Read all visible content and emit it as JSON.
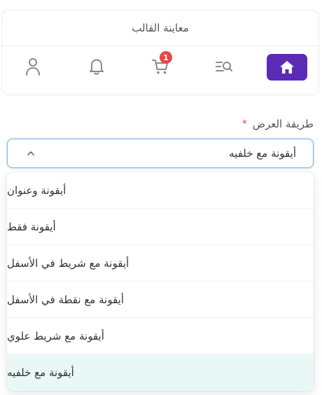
{
  "preview": {
    "title": "معاينة القالب",
    "nav_icons": [
      "home-icon",
      "search-list-icon",
      "cart-icon",
      "bell-icon",
      "user-icon"
    ],
    "cart_badge": "1"
  },
  "display_mode": {
    "label": "طريقة العرض",
    "required_mark": "*",
    "selected_value": "أيقونة مع خلفيه",
    "options": [
      "أيقونة وعنوان",
      "أيقونة فقط",
      "أيقونة مع شريط في الأسفل",
      "أيقونة مع نقطة في الأسفل",
      "أيقونة مع شريط علوي",
      "أيقونة مع خلفيه"
    ]
  },
  "colors": {
    "accent": "#5b2bb5",
    "badge": "#e84545",
    "focus_border": "#7fb3e6",
    "selected_option_bg": "#e9f8f6"
  }
}
